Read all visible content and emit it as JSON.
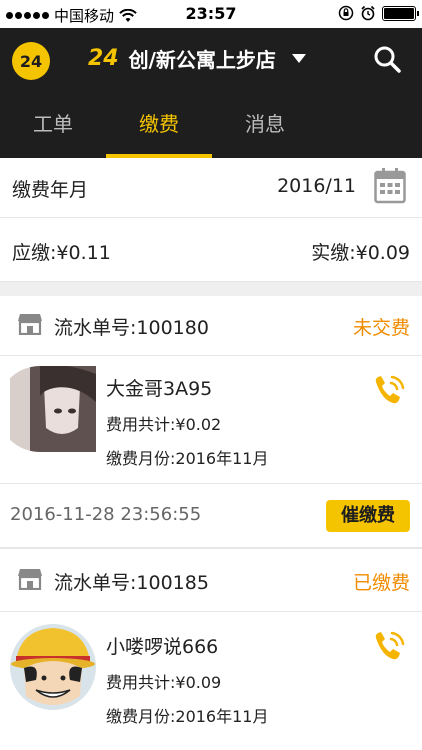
{
  "status_bar": {
    "carrier": "中国移动",
    "time": "23:57"
  },
  "header": {
    "logo": "24",
    "store_number": "24",
    "store_name": "创/新公寓上步店"
  },
  "tabs": [
    {
      "label": "工单"
    },
    {
      "label": "缴费"
    },
    {
      "label": "消息"
    }
  ],
  "filter": {
    "month_label": "缴费年月",
    "month_value": "2016/11"
  },
  "summary": {
    "due": "应缴:¥0.11",
    "paid": "实缴:¥0.09"
  },
  "orders": [
    {
      "serial": "流水单号:100180",
      "status": "未交费",
      "name": "大金哥3A95",
      "total": "费用共计:¥0.02",
      "month": "缴费月份:2016年11月",
      "time": "2016-11-28 23:56:55",
      "action": "催缴费"
    },
    {
      "serial": "流水单号:100185",
      "status": "已缴费",
      "name": "小喽啰说666",
      "total": "费用共计:¥0.09",
      "month": "缴费月份:2016年11月"
    }
  ],
  "colors": {
    "accent": "#f5c400",
    "status": "#f08c00",
    "header_bg": "#1e1e1e"
  }
}
